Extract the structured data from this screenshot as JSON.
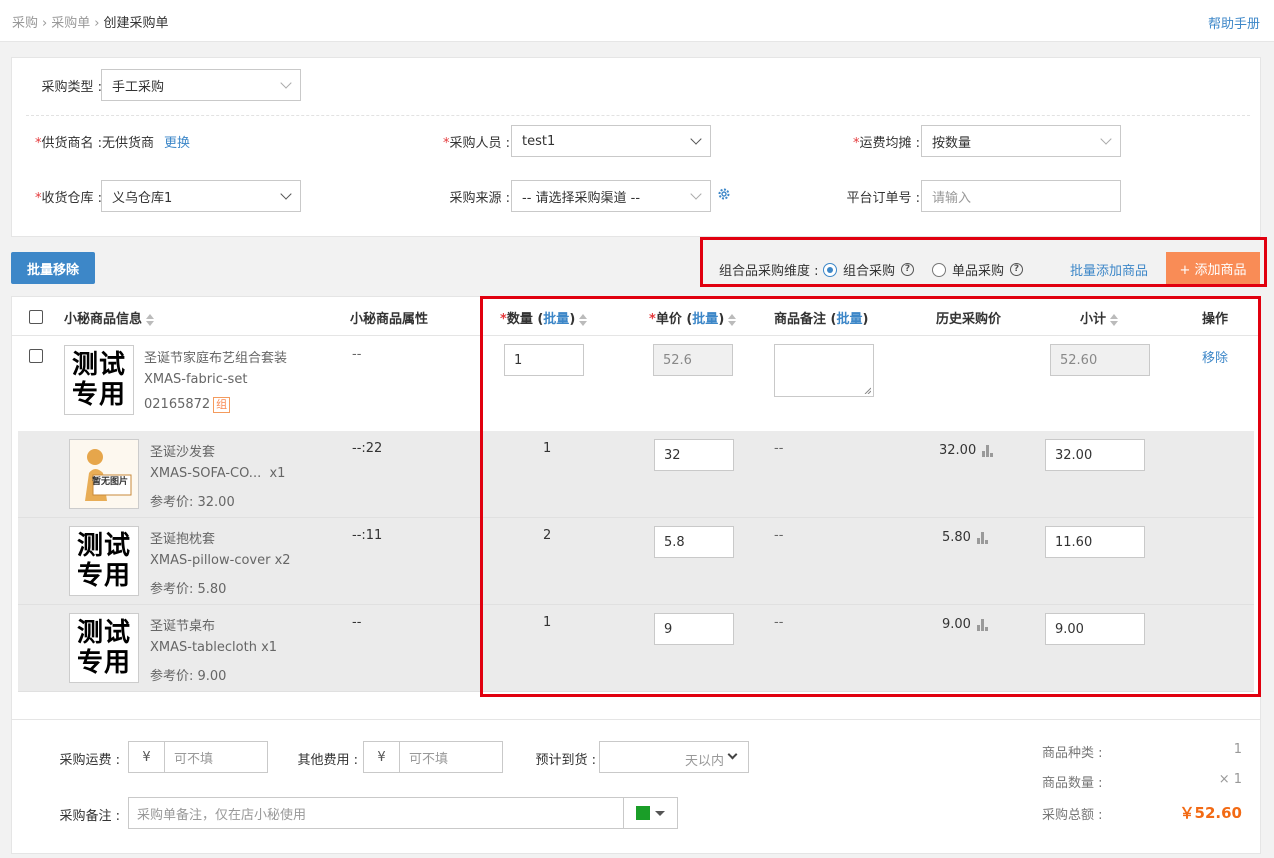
{
  "breadcrumb": {
    "items": [
      "采购",
      "采购单",
      "创建采购单"
    ]
  },
  "header": {
    "help_label": "帮助手册"
  },
  "form": {
    "purchase_type_label": "采购类型 :",
    "purchase_type_value": "手工采购",
    "supplier_label": "供货商名 :",
    "supplier_value": "无供货商",
    "supplier_change": "更换",
    "buyer_label": "采购人员 :",
    "buyer_value": "test1",
    "freight_label": "运费均摊 :",
    "freight_value": "按数量",
    "warehouse_label": "收货仓库 :",
    "warehouse_value": "义乌仓库1",
    "source_label": "采购来源 :",
    "source_value": "-- 请选择采购渠道 --",
    "platform_order_label": "平台订单号 :",
    "platform_order_placeholder": "请输入"
  },
  "toolbar": {
    "batch_remove": "批量移除",
    "dimension_label": "组合品采购维度 :",
    "option_combo": "组合采购",
    "option_single": "单品采购",
    "selected_option": "组合采购",
    "batch_add": "批量添加商品",
    "add_product": "+ 添加商品"
  },
  "table": {
    "headers": {
      "info": "小秘商品信息",
      "attr": "小秘商品属性",
      "qty": "数量",
      "price": "单价",
      "note": "商品备注",
      "history": "历史采购价",
      "subtotal": "小计",
      "action": "操作",
      "batch": "批量",
      "required_mark": "*"
    },
    "main_row": {
      "name": "圣诞节家庭布艺组合套装",
      "sku": "XMAS-fabric-set",
      "code": "02165872",
      "tag": "组",
      "attr": "--",
      "qty": "1",
      "price": "52.6",
      "subtotal": "52.60",
      "action": "移除",
      "thumb_text": "测试专用"
    },
    "sub_rows": [
      {
        "name": "圣诞沙发套",
        "sku": "XMAS-SOFA-CO...",
        "mult": "x1",
        "ref": "参考价: 32.00",
        "attr": "--:22",
        "qty": "1",
        "price": "32",
        "note": "--",
        "history": "32.00",
        "subtotal": "32.00",
        "thumb_text": "暂无图片"
      },
      {
        "name": "圣诞抱枕套",
        "sku": "XMAS-pillow-cover",
        "mult": "x2",
        "ref": "参考价: 5.80",
        "attr": "--:11",
        "qty": "2",
        "price": "5.8",
        "note": "--",
        "history": "5.80",
        "subtotal": "11.60",
        "thumb_text": "测试专用"
      },
      {
        "name": "圣诞节桌布",
        "sku": "XMAS-tablecloth",
        "mult": "x1",
        "ref": "参考价: 9.00",
        "attr": "--",
        "qty": "1",
        "price": "9",
        "note": "--",
        "history": "9.00",
        "subtotal": "9.00",
        "thumb_text": "测试专用"
      }
    ]
  },
  "footer": {
    "freight_label": "采购运费 :",
    "other_label": "其他费用 :",
    "currency": "¥",
    "optional_placeholder": "可不填",
    "eta_label": "预计到货 :",
    "eta_suffix": "天以内",
    "remark_label": "采购备注 :",
    "remark_placeholder": "采购单备注，仅在店小秘使用",
    "color_flag": "#1a9e28",
    "summary": {
      "kinds_label": "商品种类 :",
      "kinds_value": "1",
      "count_label": "商品数量 :",
      "count_value": "× 1",
      "total_label": "采购总额 :",
      "total_value": "￥52.60"
    }
  },
  "colors": {
    "accent": "#3d87c8",
    "highlight_border": "#e1000f",
    "add_button": "#f98c56",
    "total": "#f26a14"
  }
}
